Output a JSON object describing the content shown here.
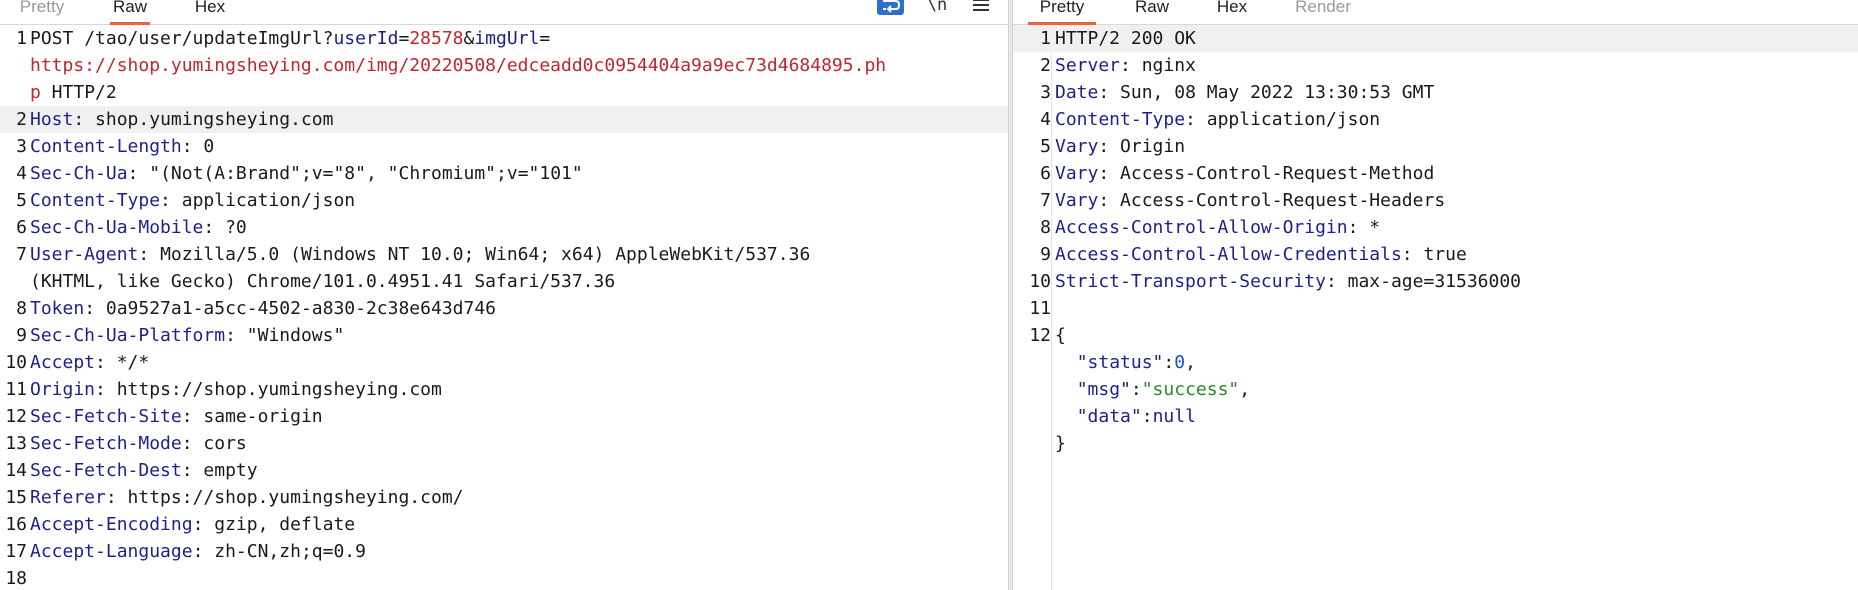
{
  "request_tabs": [
    "Pretty",
    "Raw",
    "Hex"
  ],
  "request_active_tab": "Raw",
  "request_toolbar": {
    "wrap_icon": "wrap-lines-icon",
    "newline_label": "\\n",
    "menu_icon": "hamburger-menu-icon"
  },
  "request": {
    "line1": {
      "num": "1",
      "method": "POST ",
      "path": "/tao/user/updateImgUrl?",
      "p1_key": "userId",
      "eq1": "=",
      "p1_val": "28578",
      "amp": "&",
      "p2_key": "imgUrl",
      "eq2": "=",
      "url_a": "https://shop.yumingsheying.com/img/20220508/edceadd0c0954404a9a9ec73d4684895.ph",
      "url_b": "p",
      "proto": " HTTP/2"
    },
    "headers": [
      {
        "num": "2",
        "key": "Host",
        "value": "shop.yumingsheying.com"
      },
      {
        "num": "3",
        "key": "Content-Length",
        "value": "0"
      },
      {
        "num": "4",
        "key": "Sec-Ch-Ua",
        "value": "\"(Not(A:Brand\";v=\"8\", \"Chromium\";v=\"101\""
      },
      {
        "num": "5",
        "key": "Content-Type",
        "value": "application/json"
      },
      {
        "num": "6",
        "key": "Sec-Ch-Ua-Mobile",
        "value": "?0"
      },
      {
        "num": "7",
        "key": "User-Agent",
        "value": "Mozilla/5.0 (Windows NT 10.0; Win64; x64) AppleWebKit/537.36",
        "cont": "(KHTML, like Gecko) Chrome/101.0.4951.41 Safari/537.36"
      },
      {
        "num": "8",
        "key": "Token",
        "value": "0a9527a1-a5cc-4502-a830-2c38e643d746"
      },
      {
        "num": "9",
        "key": "Sec-Ch-Ua-Platform",
        "value": "\"Windows\""
      },
      {
        "num": "10",
        "key": "Accept",
        "value": "*/*"
      },
      {
        "num": "11",
        "key": "Origin",
        "value": "https://shop.yumingsheying.com"
      },
      {
        "num": "12",
        "key": "Sec-Fetch-Site",
        "value": "same-origin"
      },
      {
        "num": "13",
        "key": "Sec-Fetch-Mode",
        "value": "cors"
      },
      {
        "num": "14",
        "key": "Sec-Fetch-Dest",
        "value": "empty"
      },
      {
        "num": "15",
        "key": "Referer",
        "value": "https://shop.yumingsheying.com/"
      },
      {
        "num": "16",
        "key": "Accept-Encoding",
        "value": "gzip, deflate"
      },
      {
        "num": "17",
        "key": "Accept-Language",
        "value": "zh-CN,zh;q=0.9"
      }
    ],
    "last_num": "18"
  },
  "response_tabs": [
    "Pretty",
    "Raw",
    "Hex",
    "Render"
  ],
  "response_active_tab": "Pretty",
  "response": {
    "status_num": "1",
    "status_line": "HTTP/2 200 OK",
    "headers": [
      {
        "num": "2",
        "key": "Server",
        "value": "nginx"
      },
      {
        "num": "3",
        "key": "Date",
        "value": "Sun, 08 May 2022 13:30:53 GMT"
      },
      {
        "num": "4",
        "key": "Content-Type",
        "value": "application/json"
      },
      {
        "num": "5",
        "key": "Vary",
        "value": "Origin"
      },
      {
        "num": "6",
        "key": "Vary",
        "value": "Access-Control-Request-Method"
      },
      {
        "num": "7",
        "key": "Vary",
        "value": "Access-Control-Request-Headers"
      },
      {
        "num": "8",
        "key": "Access-Control-Allow-Origin",
        "value": "*"
      },
      {
        "num": "9",
        "key": "Access-Control-Allow-Credentials",
        "value": "true"
      },
      {
        "num": "10",
        "key": "Strict-Transport-Security",
        "value": "max-age=31536000"
      }
    ],
    "blank_num": "11",
    "body_num": "12",
    "body_open": "{",
    "body_close": "}",
    "json": {
      "status_key": "\"status\"",
      "status_val": "0",
      "msg_key": "\"msg\"",
      "msg_val": "\"success\"",
      "data_key": "\"data\"",
      "data_val": "null"
    }
  },
  "colors": {
    "accent_tab": "#e8663a",
    "header_key": "#1f1f8c",
    "url_red": "#c0262d",
    "json_string": "#2a8a2a",
    "json_number": "#1e4fc1",
    "wrap_button": "#2c6fd1"
  }
}
